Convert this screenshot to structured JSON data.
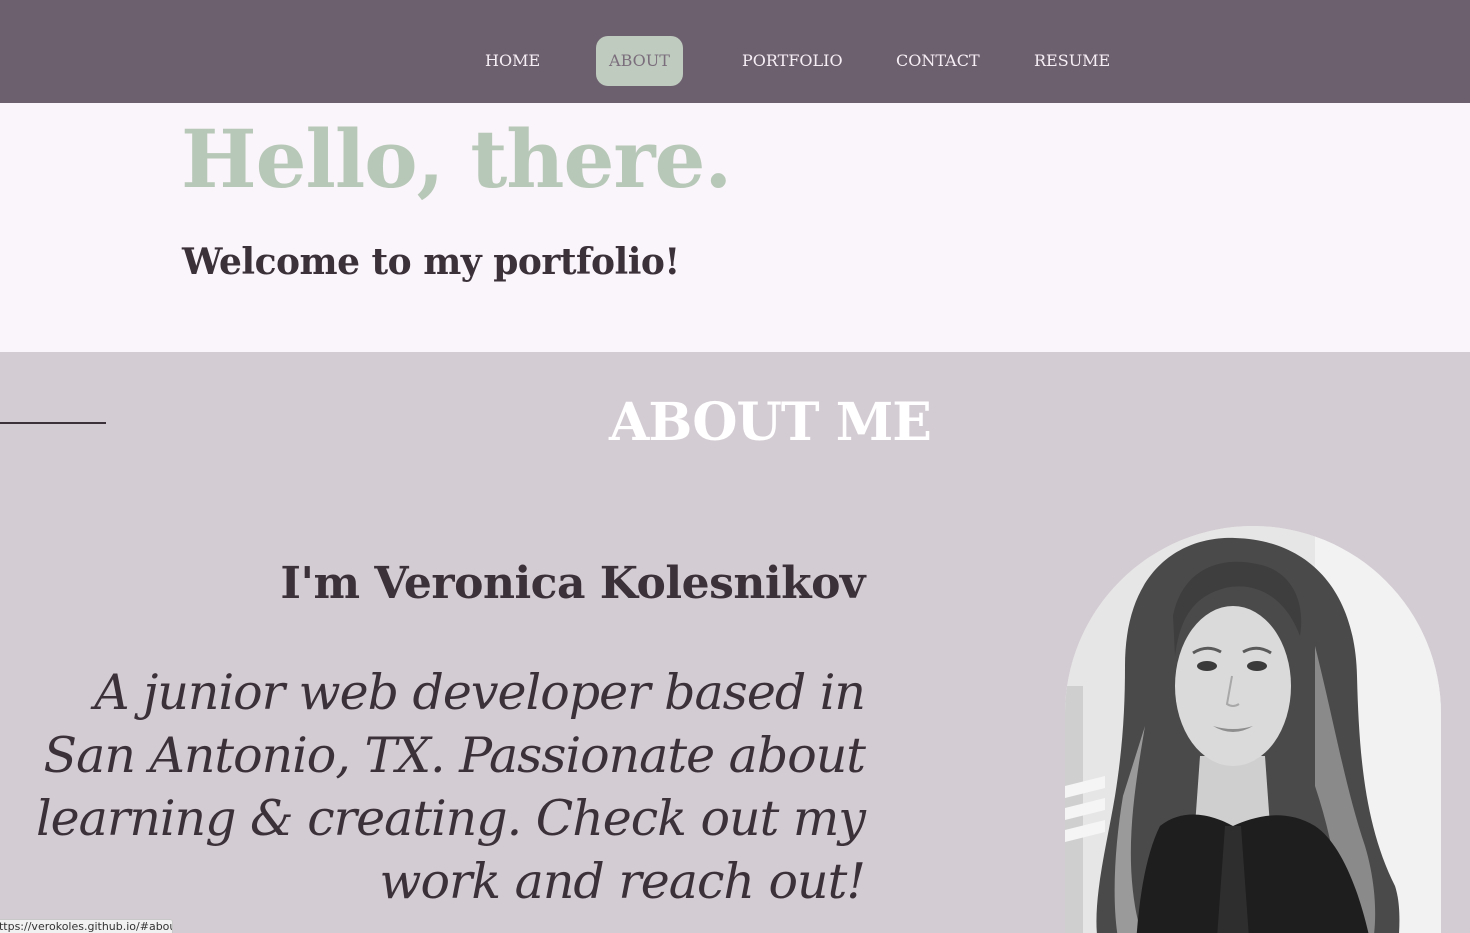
{
  "nav": {
    "items": [
      {
        "label": "HOME"
      },
      {
        "label": "ABOUT",
        "active": true
      },
      {
        "label": "PORTFOLIO"
      },
      {
        "label": "CONTACT"
      },
      {
        "label": "RESUME"
      }
    ]
  },
  "hero": {
    "title": "Hello, there.",
    "subtitle": "Welcome to my portfolio!"
  },
  "about": {
    "heading": "ABOUT ME",
    "name": "I'm Veronica Kolesnikov",
    "bio": "A junior web developer based in San Antonio, TX. Passionate about learning & creating. Check out my work and reach out!",
    "portrait": "portrait-photo"
  },
  "status_bar": {
    "url": "https://verokoles.github.io/#about"
  },
  "colors": {
    "nav_bg": "#6d606e",
    "nav_active_bg": "#bfcbbf",
    "hero_bg": "#faf5fa",
    "hero_title": "#b8c8b8",
    "about_bg": "#d4ccd3",
    "text_dark": "#3b3139"
  }
}
